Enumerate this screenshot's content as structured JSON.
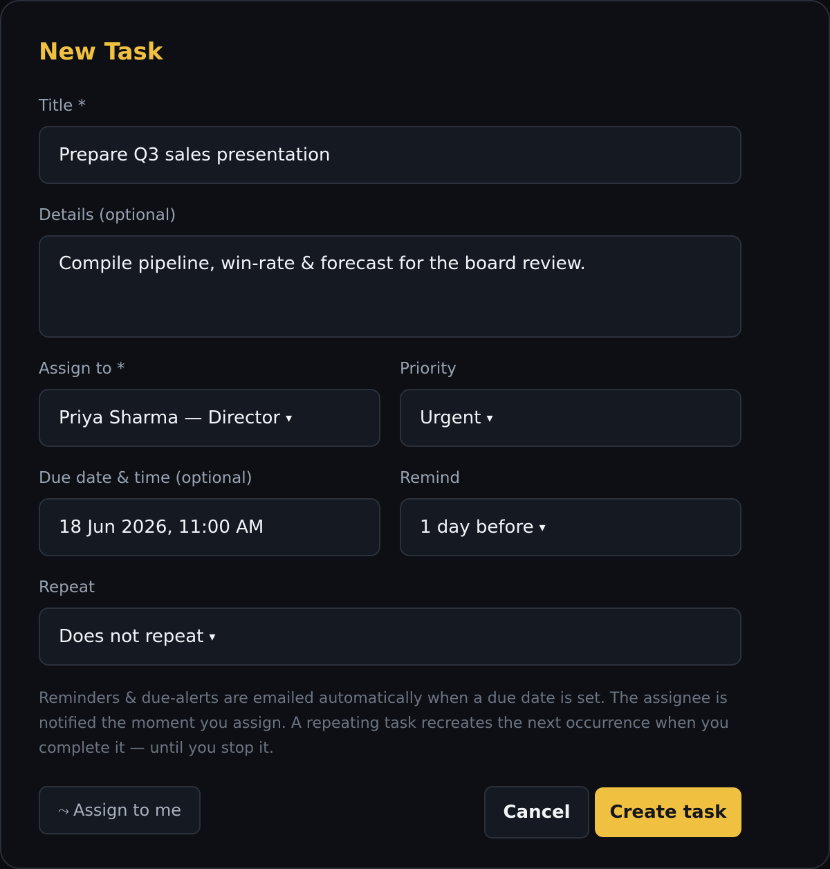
{
  "dialog": {
    "title": "New Task"
  },
  "form": {
    "title": {
      "label": "Title *",
      "value": "Prepare Q3 sales presentation"
    },
    "details": {
      "label": "Details (optional)",
      "value": "Compile pipeline, win-rate & forecast for the board review."
    },
    "assign_to": {
      "label": "Assign to *",
      "value": "Priya Sharma — Director",
      "caret": "▾"
    },
    "priority": {
      "label": "Priority",
      "value": "Urgent",
      "caret": "▾"
    },
    "due_date": {
      "label": "Due date & time (optional)",
      "value": "18 Jun 2026, 11:00 AM"
    },
    "remind": {
      "label": "Remind",
      "value": "1 day before",
      "caret": "▾"
    },
    "repeat": {
      "label": "Repeat",
      "value": "Does not repeat",
      "caret": "▾"
    }
  },
  "helper_text": "Reminders & due-alerts are emailed automatically when a due date is set. The assignee is notified the moment you assign. A repeating task recreates the next occurrence when you complete it — until you stop it.",
  "actions": {
    "assign_to_me": {
      "icon": "⤳",
      "label": "Assign to me"
    },
    "cancel": "Cancel",
    "create": "Create task"
  },
  "colors": {
    "accent": "#f0c040",
    "background": "#0d0f14",
    "field_bg": "#151922",
    "border": "#2b303b",
    "label": "#9aa3b2",
    "helper": "#6c7482"
  }
}
